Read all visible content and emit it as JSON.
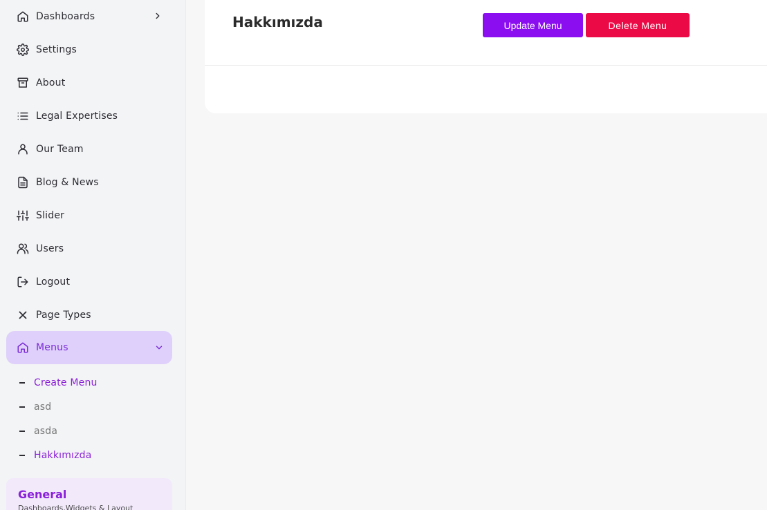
{
  "sidebar": {
    "items": [
      {
        "label": "Dashboards",
        "icon": "home-icon"
      },
      {
        "label": "Settings",
        "icon": "gear-icon"
      },
      {
        "label": "About",
        "icon": "archive-icon"
      },
      {
        "label": "Legal Expertises",
        "icon": "list-icon"
      },
      {
        "label": "Our Team",
        "icon": "user-icon"
      },
      {
        "label": "Blog & News",
        "icon": "document-icon"
      },
      {
        "label": "Slider",
        "icon": "sliders-icon"
      },
      {
        "label": "Users",
        "icon": "users-icon"
      },
      {
        "label": "Logout",
        "icon": "logout-icon"
      },
      {
        "label": "Page Types",
        "icon": "x-icon"
      },
      {
        "label": "Menus",
        "icon": "home-icon"
      }
    ],
    "submenu": [
      {
        "label": "Create Menu"
      },
      {
        "label": "asd"
      },
      {
        "label": "asda"
      },
      {
        "label": "Hakkımızda"
      }
    ],
    "general": {
      "title": "General",
      "subtitle": "Dashboards,Widgets & Layout"
    }
  },
  "main": {
    "title": "Hakkımızda",
    "update_button": "Update Menu",
    "delete_button": "Delete Menu"
  },
  "colors": {
    "accent": "#8a20d8",
    "active_bg": "#dfd0fb",
    "update": "#8a0ef0",
    "delete": "#ec0a46"
  }
}
